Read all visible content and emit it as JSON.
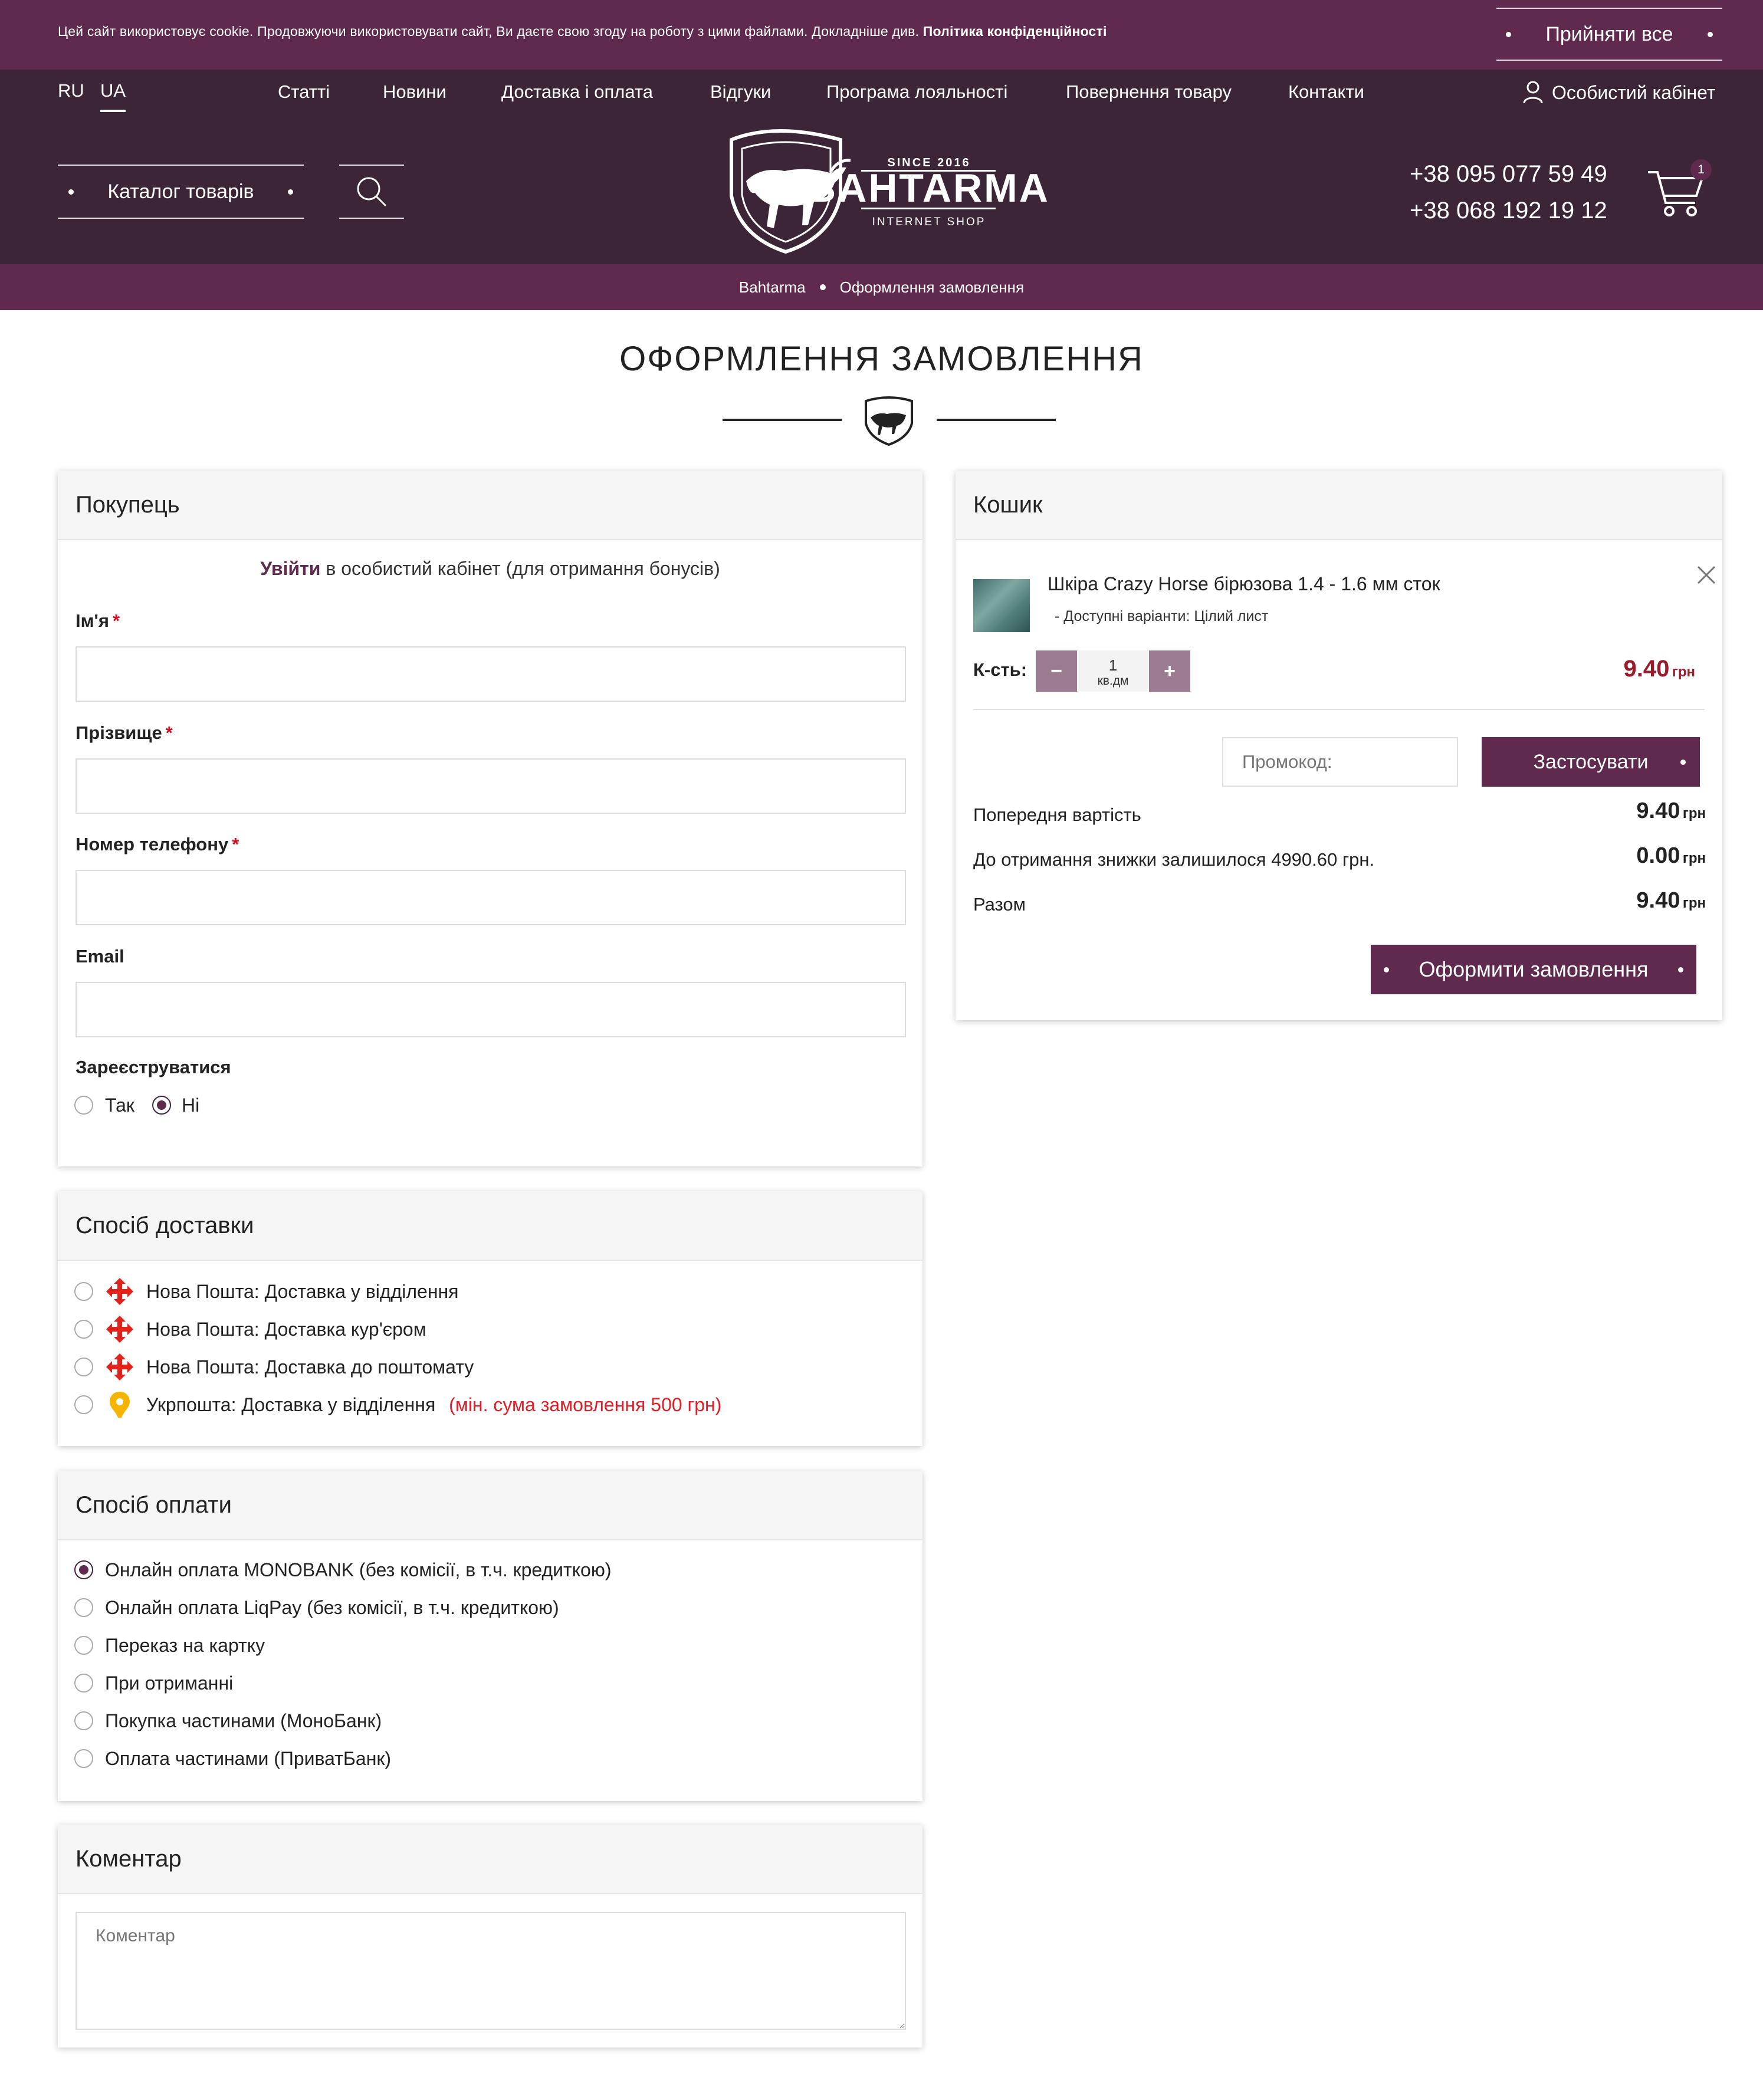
{
  "cookie": {
    "text": "Цей сайт використовує cookie. Продовжуючи використовувати сайт, Ви даєте свою згоду на роботу з цими файлами. Докладніше див.",
    "policy_link": "Політика конфіденційності",
    "accept_label": "Прийняти все"
  },
  "topnav": {
    "lang_ru": "RU",
    "lang_ua": "UA",
    "links": [
      "Статті",
      "Новини",
      "Доставка і оплата",
      "Відгуки",
      "Програма лояльності",
      "Повернення товару",
      "Контакти"
    ],
    "account_label": "Особистий кабінет"
  },
  "header": {
    "catalog_label": "Каталог товарів",
    "logo": {
      "since": "SINCE 2016",
      "name": "BAHTARMA",
      "tagline": "INTERNET SHOP"
    },
    "phones": [
      "+38 095 077 59 49",
      "+38 068 192 19 12"
    ],
    "cart_count": "1"
  },
  "breadcrumb": {
    "home": "Bahtarma",
    "current": "Оформлення замовлення"
  },
  "page_title": "ОФОРМЛЕННЯ ЗАМОВЛЕННЯ",
  "buyer": {
    "title": "Покупець",
    "login_link": "Увійти",
    "login_text": "в особистий кабінет (для отримання бонусів)",
    "first_name_label": "Ім'я",
    "last_name_label": "Прізвище",
    "phone_label": "Номер телефону",
    "email_label": "Email",
    "required_mark": "*",
    "register_label": "Зареєструватися",
    "register_yes": "Так",
    "register_no": "Ні"
  },
  "delivery": {
    "title": "Спосіб доставки",
    "options": [
      "Нова Пошта: Доставка у відділення",
      "Нова Пошта: Доставка кур'єром",
      "Нова Пошта: Доставка до поштомату",
      "Укрпошта: Доставка у відділення"
    ],
    "ukrposhta_note": "(мін. сума замовлення 500 грн)"
  },
  "payment": {
    "title": "Спосіб оплати",
    "options": [
      "Онлайн оплата MONOBANK (без комісії, в т.ч. кредиткою)",
      "Онлайн оплата LiqPay (без комісії, в т.ч. кредиткою)",
      "Переказ на картку",
      "При отриманні",
      "Покупка частинами (МоноБанк)",
      "Оплата частинами (ПриватБанк)"
    ],
    "selected_index": 0
  },
  "comment": {
    "title": "Коментар",
    "placeholder": "Коментар"
  },
  "cart": {
    "title": "Кошик",
    "item_name": "Шкіра Crazy Horse бірюзова 1.4 - 1.6 мм сток",
    "item_variant": "- Доступні варіанти: Цілий лист",
    "qty_label": "К-сть:",
    "qty_minus": "−",
    "qty_plus": "+",
    "qty_value": "1",
    "qty_unit": "кв.дм",
    "item_price": "9.40",
    "currency": "грн",
    "promo_placeholder": "Промокод:",
    "apply_label": "Застосувати",
    "subtotal_label": "Попередня вартість",
    "subtotal_value": "9.40",
    "discount_label": "До отримання знижки залишилося 4990.60 грн.",
    "discount_value": "0.00",
    "total_label": "Разом",
    "total_value": "9.40",
    "checkout_label": "Оформити замовлення"
  },
  "colors": {
    "brand": "#5f2a4e",
    "header_bg": "#3c2536",
    "price": "#9b1b2a",
    "required": "#d01020"
  }
}
